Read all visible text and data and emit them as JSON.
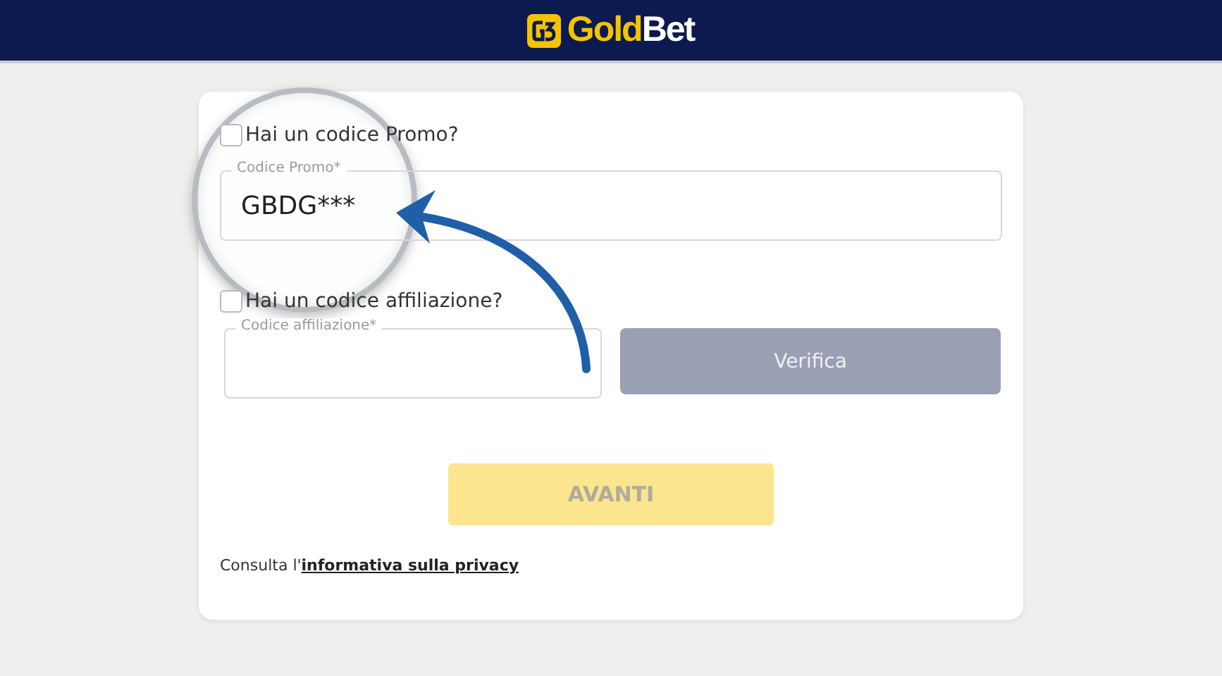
{
  "header": {
    "logo": {
      "part_1": "Gold",
      "part_2": "Bet"
    }
  },
  "promo": {
    "checkbox": {
      "label": "Hai un codice Promo?",
      "checked": false
    },
    "field": {
      "label": "Codice Promo*",
      "value": "GBDG***"
    }
  },
  "affiliation": {
    "checkbox": {
      "label": "Hai un codice affiliazione?",
      "checked": false
    },
    "field": {
      "label": "Codice affiliazione*"
    },
    "button": {
      "label": "Verifica",
      "disabled": true
    }
  },
  "next_button": {
    "label": "AVANTI",
    "disabled": true
  },
  "privacy": {
    "text": "Consulta l'",
    "link": "informativa sulla privacy"
  }
}
